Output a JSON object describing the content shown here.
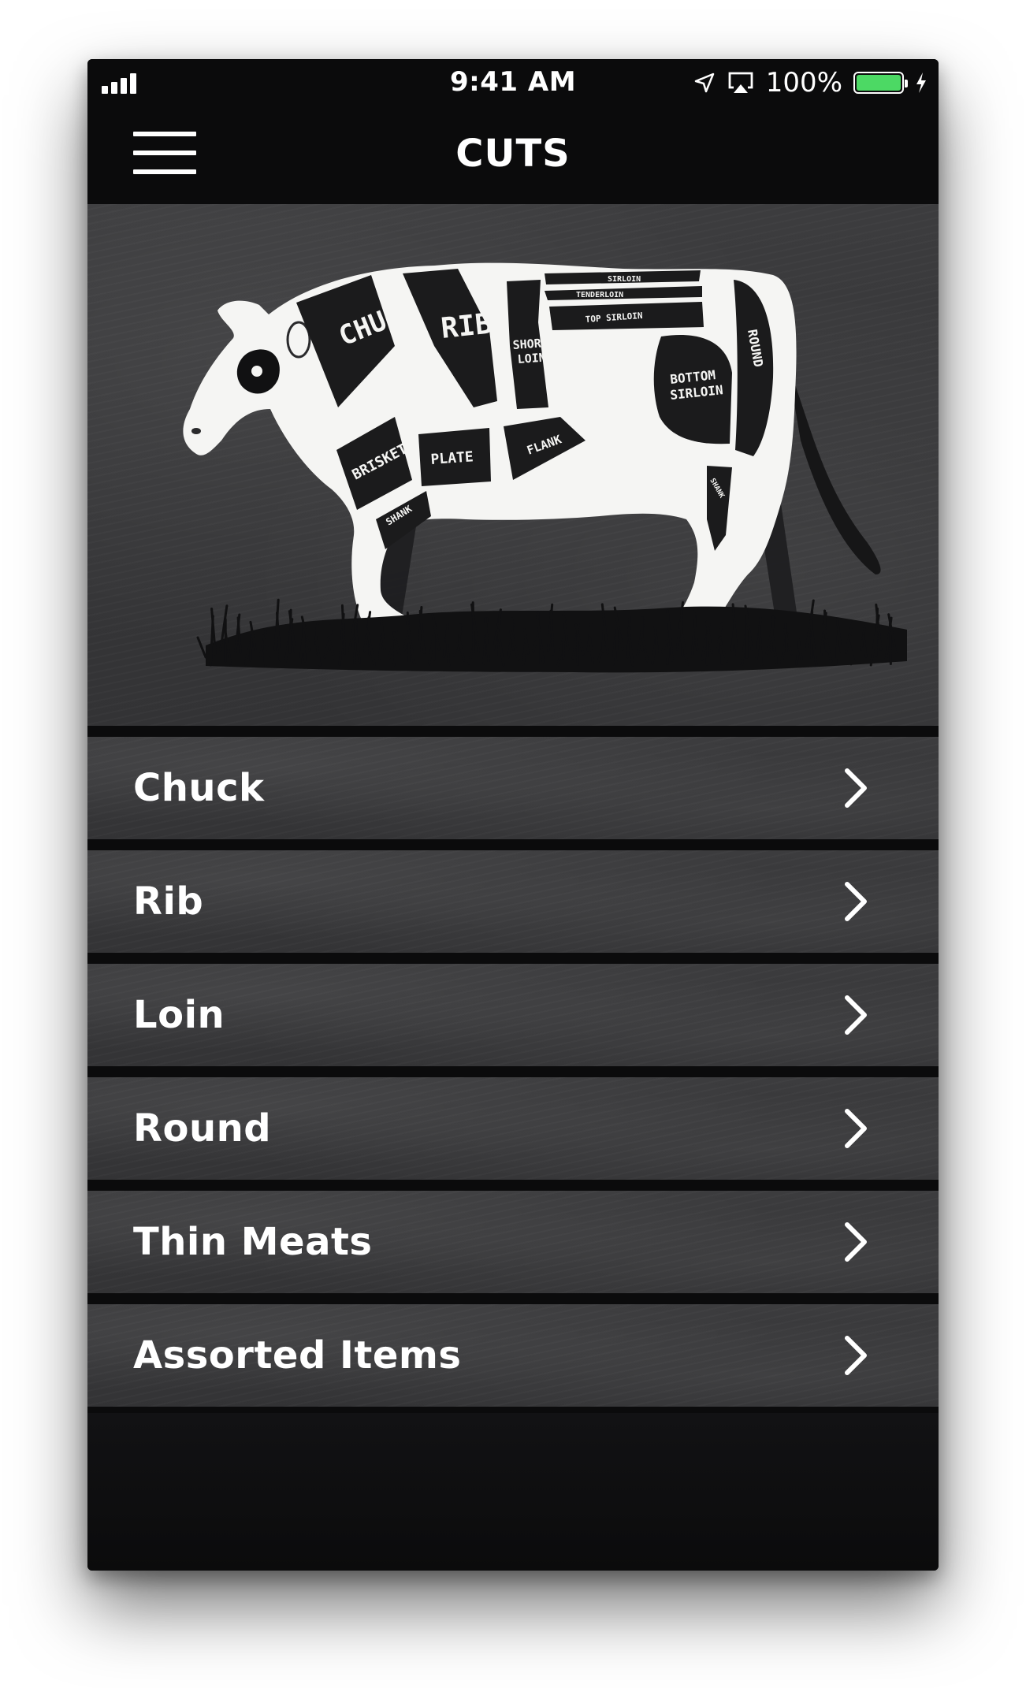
{
  "status_bar": {
    "time": "9:41 AM",
    "battery_percent": "100%",
    "battery_level": 1.0,
    "icons": [
      "cellular-signal-icon",
      "location-arrow-icon",
      "airplay-icon",
      "battery-icon",
      "charging-bolt-icon"
    ]
  },
  "nav": {
    "title": "CUTS",
    "menu_icon": "hamburger-menu-icon"
  },
  "diagram": {
    "labels": {
      "chuck": "CHUCK",
      "rib": "RIB",
      "short_loin": [
        "SHORT",
        "LOIN"
      ],
      "sirloin": "SIRLOIN",
      "tenderloin": "TENDERLOIN",
      "top_sirloin": "TOP SIRLOIN",
      "bottom_sirloin": [
        "BOTTOM",
        "SIRLOIN"
      ],
      "round": "ROUND",
      "brisket": "BRISKET",
      "plate": "PLATE",
      "flank": "FLANK",
      "front_shank": "SHANK",
      "rear_shank": "SHANK"
    }
  },
  "list": {
    "items": [
      {
        "label": "Chuck"
      },
      {
        "label": "Rib"
      },
      {
        "label": "Loin"
      },
      {
        "label": "Round"
      },
      {
        "label": "Thin Meats"
      },
      {
        "label": "Assorted Items"
      }
    ],
    "chevron_icon": "chevron-right-icon"
  },
  "colors": {
    "background": "#0b0b0c",
    "panel": "#38383a",
    "text": "#ffffff",
    "battery": "#4cd964"
  }
}
